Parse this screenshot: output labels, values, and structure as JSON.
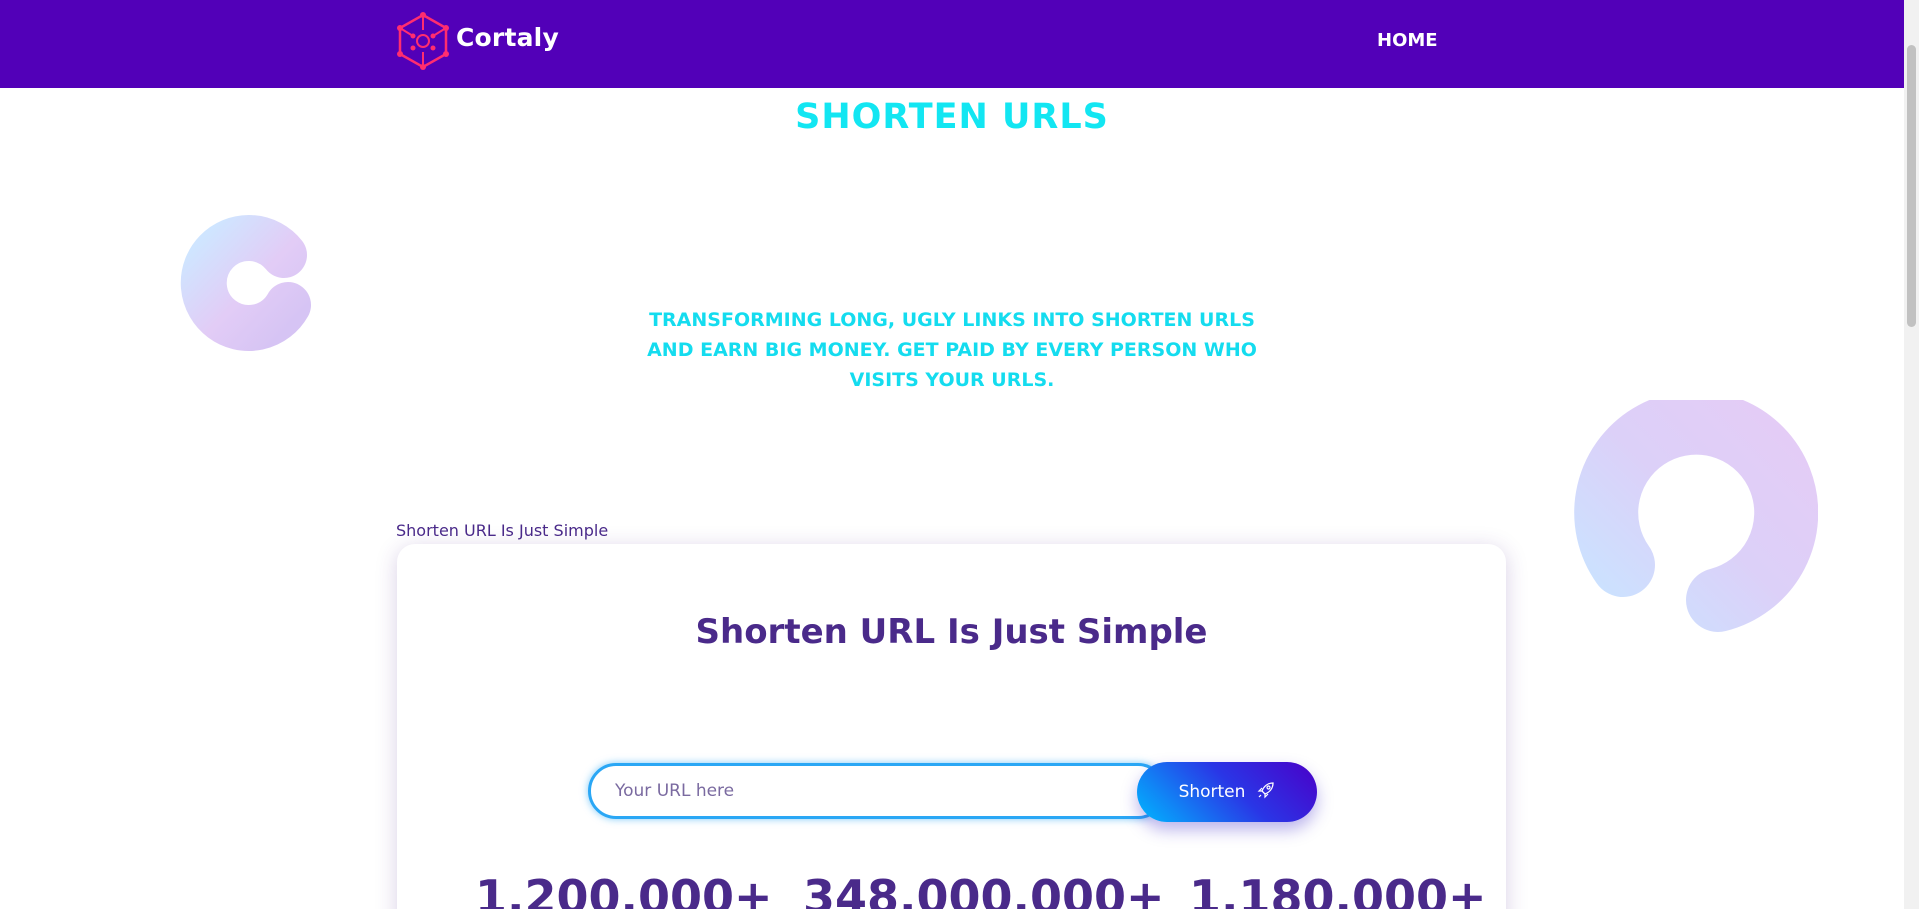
{
  "header": {
    "brand": "Cortaly",
    "nav": {
      "home": "HOME"
    },
    "background_color": "#5200b8",
    "logo_icon": "hexagon-network-icon"
  },
  "hero": {
    "title": "SHORTEN URLS",
    "description": "TRANSFORMING LONG, UGLY LINKS INTO SHORTEN URLS AND EARN BIG MONEY. GET PAID BY EVERY PERSON WHO VISITS YOUR URLS.",
    "accent_color": "#12e6f2"
  },
  "section": {
    "label": "Shorten URL Is Just Simple"
  },
  "card": {
    "title": "Shorten URL Is Just Simple",
    "input_placeholder": "Your URL here",
    "input_value": "",
    "button_label": "Shorten",
    "button_icon": "rocket-icon",
    "stats": [
      "1,200,000+",
      "348,000,000+",
      "1,180,000+"
    ]
  }
}
